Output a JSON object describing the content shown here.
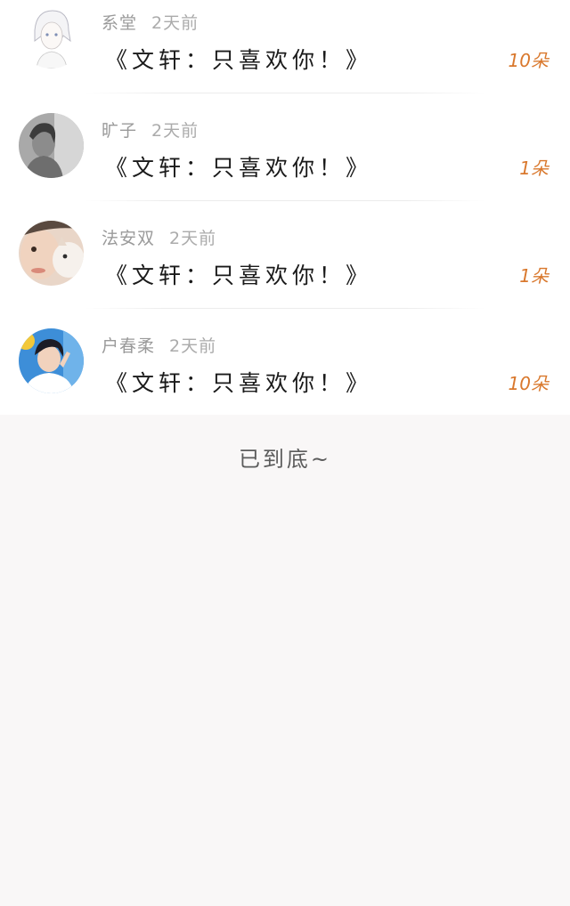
{
  "items": [
    {
      "name": "系堂",
      "time": "2天前",
      "title": "《文轩：只喜欢你！》",
      "count": "10朵"
    },
    {
      "name": "旷子",
      "time": "2天前",
      "title": "《文轩：只喜欢你！》",
      "count": "1朵"
    },
    {
      "name": "法安双",
      "time": "2天前",
      "title": "《文轩：只喜欢你！》",
      "count": "1朵"
    },
    {
      "name": "户春柔",
      "time": "2天前",
      "title": "《文轩：只喜欢你！》",
      "count": "10朵"
    }
  ],
  "footer": {
    "text": "已到底~"
  },
  "colors": {
    "accent": "#d9782d",
    "background": "#f9f7f7"
  }
}
